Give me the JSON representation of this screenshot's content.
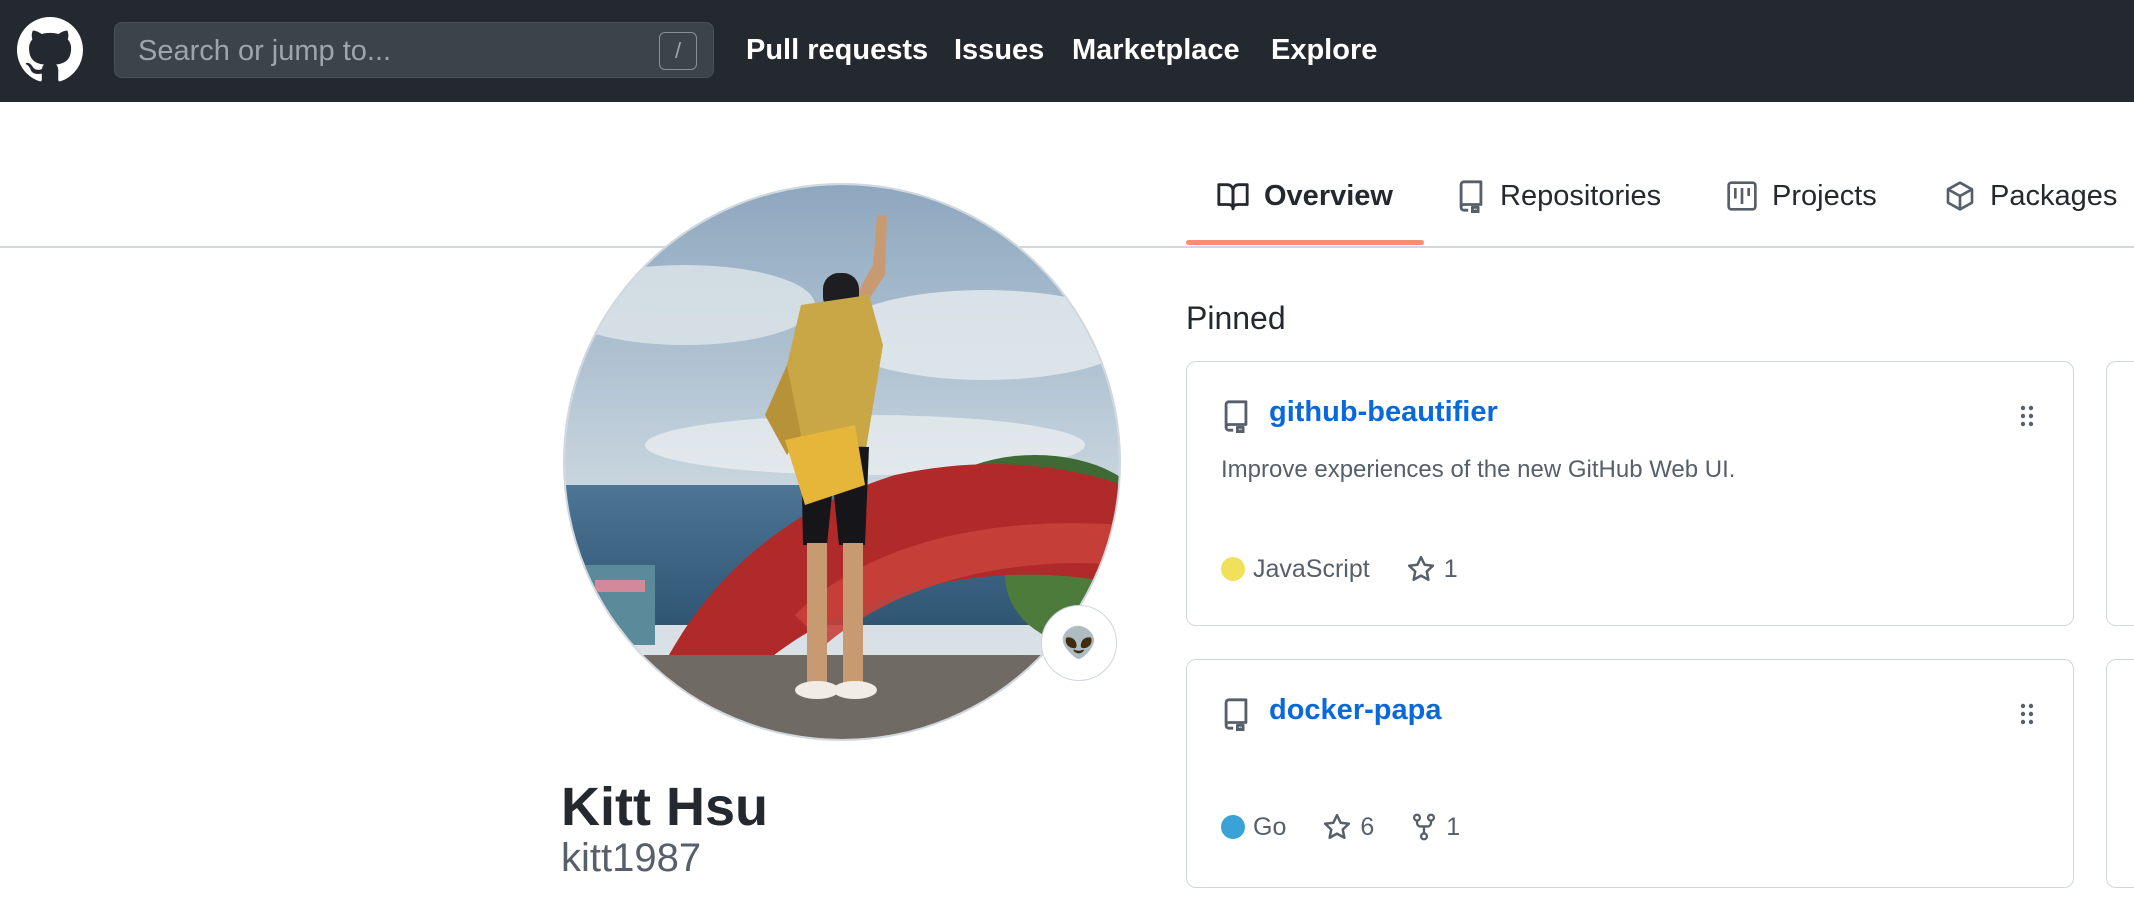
{
  "header": {
    "search_placeholder": "Search or jump to...",
    "search_shortcut": "/",
    "nav": [
      "Pull requests",
      "Issues",
      "Marketplace",
      "Explore"
    ]
  },
  "tabs": [
    {
      "label": "Overview",
      "icon": "book-icon",
      "active": true
    },
    {
      "label": "Repositories",
      "icon": "repo-icon",
      "active": false
    },
    {
      "label": "Projects",
      "icon": "project-icon",
      "active": false
    },
    {
      "label": "Packages",
      "icon": "package-icon",
      "active": false
    }
  ],
  "profile": {
    "name": "Kitt Hsu",
    "login": "kitt1987",
    "status_emoji": "👽"
  },
  "pinned": {
    "title": "Pinned",
    "repos": [
      {
        "name": "github-beautifier",
        "description": "Improve experiences of the new GitHub Web UI.",
        "language": "JavaScript",
        "language_color": "#f1e05a",
        "stars": "1"
      },
      {
        "name": "docker-papa",
        "description": "",
        "language": "Go",
        "language_color": "#00add8",
        "stars": "6",
        "forks": "1"
      }
    ]
  },
  "colors": {
    "header_bg": "#24292f",
    "link": "#0969da",
    "tab_underline": "#fd8c73"
  }
}
